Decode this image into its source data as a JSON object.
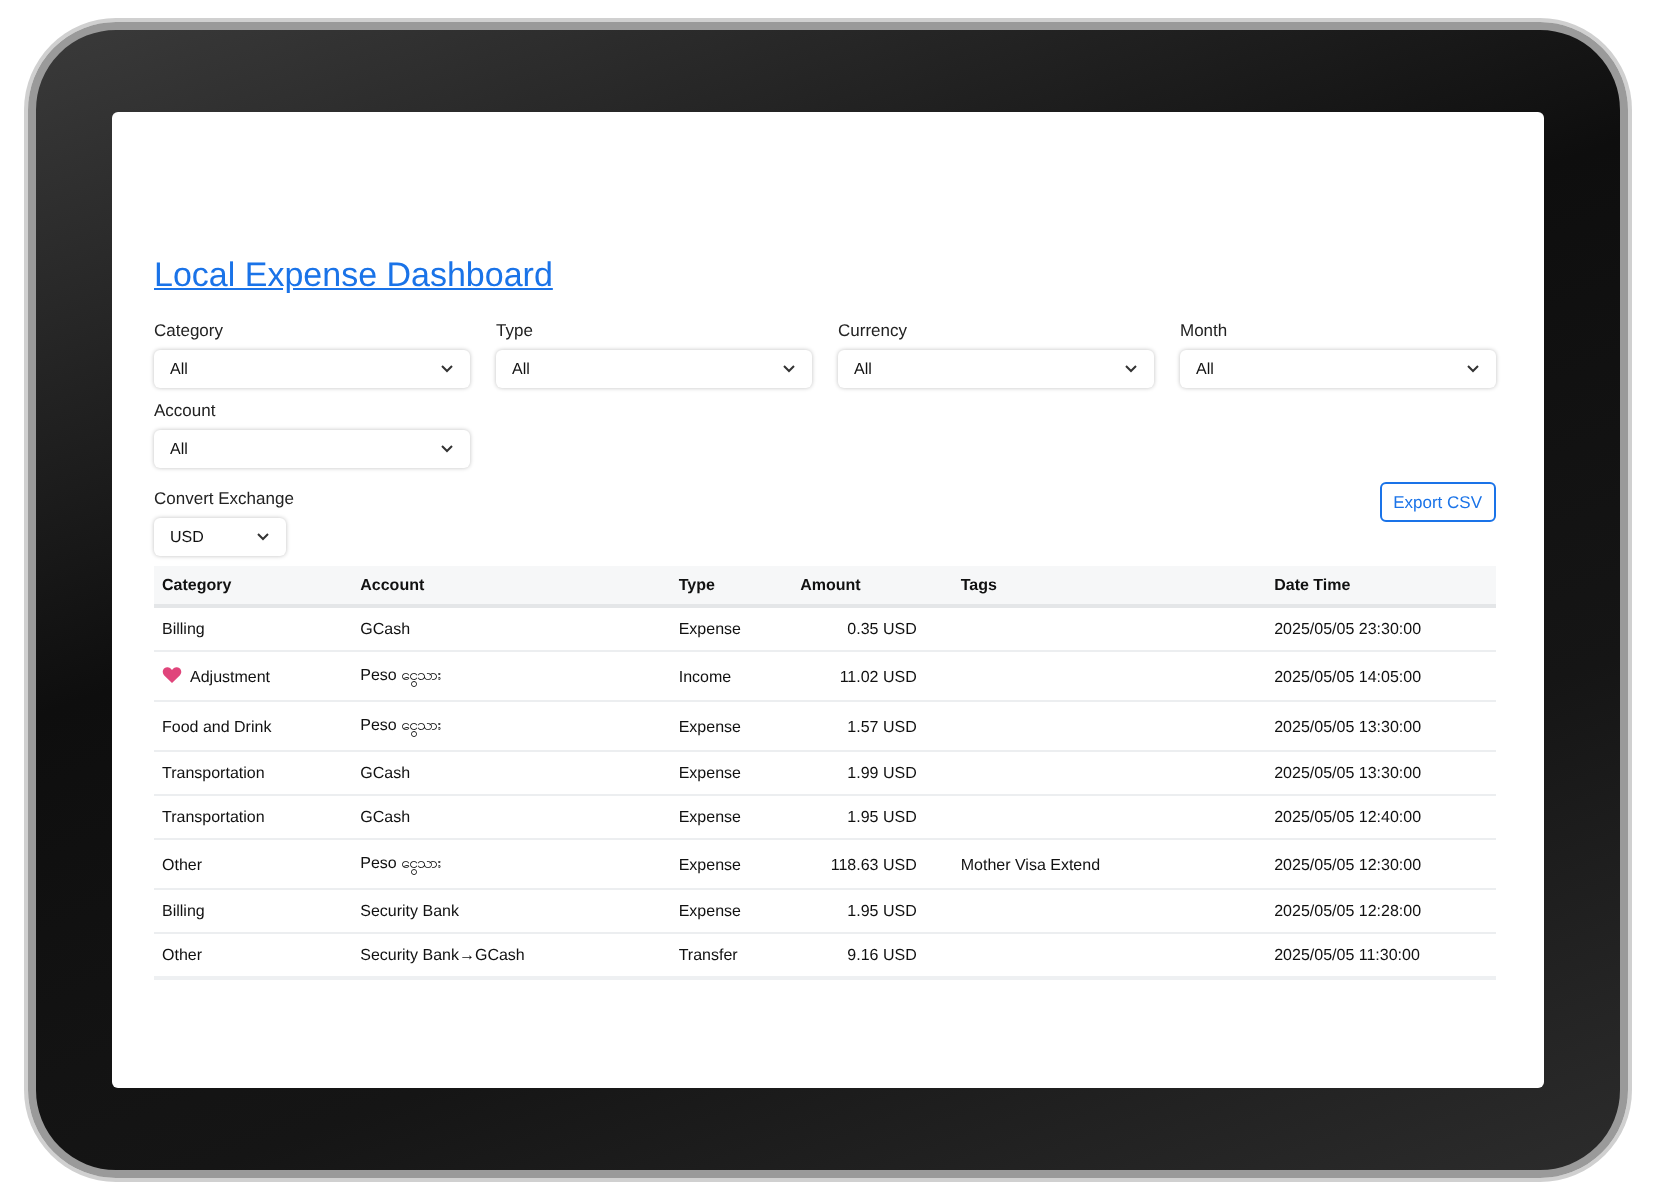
{
  "title": "Local Expense Dashboard",
  "filters": [
    {
      "label": "Category",
      "value": "All"
    },
    {
      "label": "Type",
      "value": "All"
    },
    {
      "label": "Currency",
      "value": "All"
    },
    {
      "label": "Month",
      "value": "All"
    },
    {
      "label": "Account",
      "value": "All"
    }
  ],
  "convert": {
    "label": "Convert Exchange",
    "value": "USD"
  },
  "export_button": "Export CSV",
  "table": {
    "columns": [
      "Category",
      "Account",
      "Type",
      "Amount",
      "Tags",
      "Date Time"
    ],
    "rows": [
      {
        "has_icon": false,
        "cells": [
          "Billing",
          "GCash",
          "Expense",
          "0.35 USD",
          "",
          "2025/05/05 23:30:00"
        ]
      },
      {
        "has_icon": true,
        "cells": [
          "Adjustment",
          "Peso ငွေသား",
          "Income",
          "11.02 USD",
          "",
          "2025/05/05 14:05:00"
        ]
      },
      {
        "has_icon": false,
        "cells": [
          "Food and Drink",
          "Peso ငွေသား",
          "Expense",
          "1.57 USD",
          "",
          "2025/05/05 13:30:00"
        ]
      },
      {
        "has_icon": false,
        "cells": [
          "Transportation",
          "GCash",
          "Expense",
          "1.99 USD",
          "",
          "2025/05/05 13:30:00"
        ]
      },
      {
        "has_icon": false,
        "cells": [
          "Transportation",
          "GCash",
          "Expense",
          "1.95 USD",
          "",
          "2025/05/05 12:40:00"
        ]
      },
      {
        "has_icon": false,
        "cells": [
          "Other",
          "Peso ငွေသား",
          "Expense",
          "118.63 USD",
          "Mother Visa Extend",
          "2025/05/05 12:30:00"
        ]
      },
      {
        "has_icon": false,
        "cells": [
          "Billing",
          "Security Bank",
          "Expense",
          "1.95 USD",
          "",
          "2025/05/05 12:28:00"
        ]
      },
      {
        "has_icon": false,
        "cells": [
          "Other",
          "Security Bank→GCash",
          "Transfer",
          "9.16 USD",
          "",
          "2025/05/05 11:30:00"
        ]
      }
    ]
  }
}
